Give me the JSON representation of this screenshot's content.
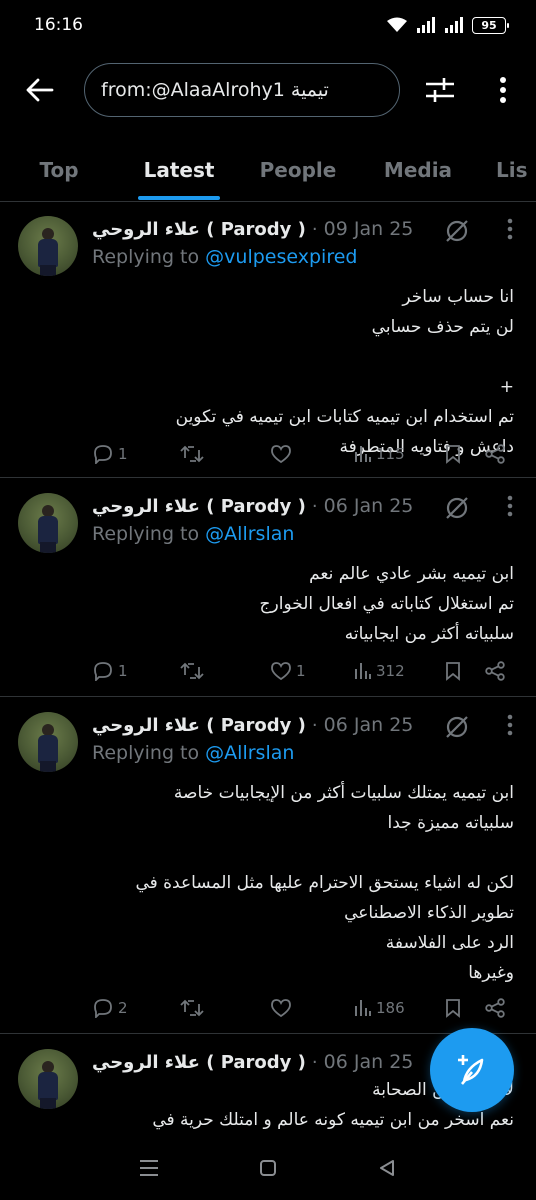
{
  "status": {
    "time": "16:16",
    "battery": "95"
  },
  "search": {
    "query": "from:@AlaaAlrohy1 تيمية"
  },
  "tabs": [
    {
      "label": "Top"
    },
    {
      "label": "Latest"
    },
    {
      "label": "People"
    },
    {
      "label": "Media"
    },
    {
      "label": "Lis"
    }
  ],
  "tweets": [
    {
      "name": "علاء الروحي ( Parody )",
      "date": "09 Jan 25",
      "reply_prefix": "Replying to",
      "reply_handle": "@vulpesexpired",
      "lines": [
        "انا حساب ساخر",
        "لن يتم حذف حسابي",
        "",
        "+",
        "تم استخدام ابن تيميه كتابات ابن تيميه في تكوين",
        "داعش و فتاويه المتطرفة"
      ],
      "replies": "1",
      "reposts": "",
      "likes": "",
      "views": "115"
    },
    {
      "name": "علاء الروحي ( Parody )",
      "date": "06 Jan 25",
      "reply_prefix": "Replying to",
      "reply_handle": "@Allrslan",
      "lines": [
        "ابن تيميه بشر عادي عالم نعم",
        "تم استغلال كتاباته في افعال الخوارج",
        "سلبياته أكثر من ايجابياته"
      ],
      "replies": "1",
      "reposts": "",
      "likes": "1",
      "views": "312"
    },
    {
      "name": "علاء الروحي ( Parody )",
      "date": "06 Jan 25",
      "reply_prefix": "Replying to",
      "reply_handle": "@Allrslan",
      "lines": [
        "ابن تيميه يمتلك سلبيات أكثر من الإيجابيات خاصة",
        "سلبياته مميزة جدا",
        "",
        "لكن له اشياء يستحق الاحترام عليها مثل المساعدة في",
        "تطوير الذكاء الاصطناعي",
        "الرد على الفلاسفة",
        "وغيرها"
      ],
      "replies": "2",
      "reposts": "",
      "likes": "",
      "views": "186"
    },
    {
      "name": "علاء الروحي ( Parody )",
      "date": "06 Jan 25",
      "lines": [
        "لا أسخر من الصحابة",
        "نعم اسخر من ابن تيميه كونه عالم و امتلك حرية في"
      ]
    }
  ],
  "colors": {
    "accent": "#1d9bf0",
    "muted": "#71767b",
    "divider": "#2f3336"
  }
}
